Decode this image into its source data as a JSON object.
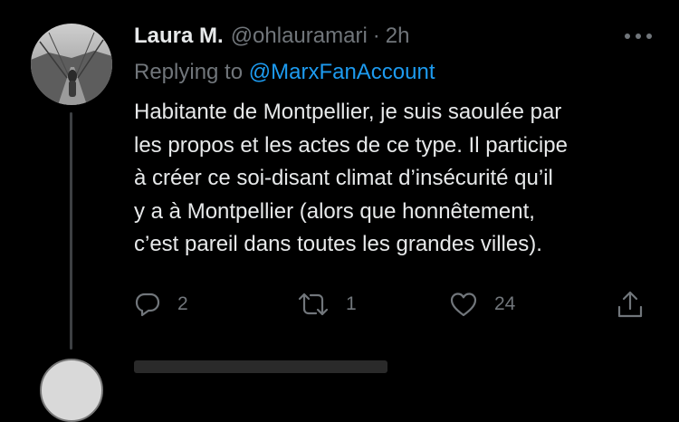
{
  "tweet": {
    "author_name": "Laura M.",
    "handle": "@ohlauramari",
    "separator": "·",
    "time": "2h",
    "reply_prefix": "Replying to",
    "reply_to": "@MarxFanAccount",
    "body_lines": [
      "Habitante de Montpellier, je suis saoulée par",
      "les propos et les actes de ce type. Il participe",
      "à créer ce soi-disant climat d’insécurité qu’il",
      "y a à Montpellier (alors que honnêtement,",
      "c’est pareil dans toutes les grandes villes)."
    ]
  },
  "actions": {
    "reply_count": "2",
    "retweet_count": "1",
    "like_count": "24"
  },
  "icons": {
    "more": "more-horizontal-icon",
    "reply": "reply-icon",
    "retweet": "retweet-icon",
    "like": "heart-icon",
    "share": "share-icon"
  },
  "colors": {
    "background": "#000000",
    "text": "#e7e9ea",
    "secondary": "#71767b",
    "link": "#1d9bf0",
    "thread_line": "#3d4043"
  }
}
